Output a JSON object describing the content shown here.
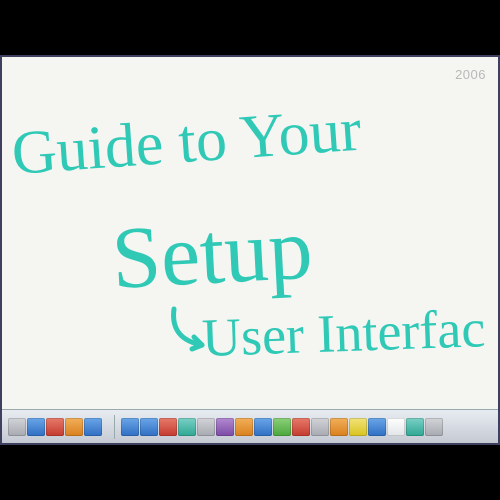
{
  "timestamp": "2006",
  "handwriting": {
    "line1": "Guide to Your",
    "line2": "Setup",
    "line3": "User Interfac"
  },
  "colors": {
    "ink": "#2fc9b6",
    "canvas": "#f5f5f2"
  },
  "taskbar": {
    "groups": [
      {
        "items": [
          {
            "name": "app-icon-1",
            "color": "c-gray"
          },
          {
            "name": "app-icon-2",
            "color": "c-blue"
          },
          {
            "name": "app-icon-3",
            "color": "c-red"
          },
          {
            "name": "app-icon-4",
            "color": "c-orange"
          },
          {
            "name": "app-icon-5",
            "color": "c-blue"
          }
        ]
      },
      {
        "items": [
          {
            "name": "tool-icon-1",
            "color": "c-blue"
          },
          {
            "name": "tool-icon-2",
            "color": "c-blue"
          },
          {
            "name": "tool-icon-3",
            "color": "c-red"
          },
          {
            "name": "tool-icon-4",
            "color": "c-teal"
          },
          {
            "name": "tool-icon-5",
            "color": "c-gray"
          },
          {
            "name": "tool-icon-6",
            "color": "c-purple"
          },
          {
            "name": "tool-icon-7",
            "color": "c-orange"
          },
          {
            "name": "tool-icon-8",
            "color": "c-blue"
          },
          {
            "name": "tool-icon-9",
            "color": "c-green"
          },
          {
            "name": "tool-icon-10",
            "color": "c-red"
          },
          {
            "name": "tool-icon-11",
            "color": "c-gray"
          },
          {
            "name": "tool-icon-12",
            "color": "c-orange"
          },
          {
            "name": "tool-icon-13",
            "color": "c-yellow"
          },
          {
            "name": "tool-icon-14",
            "color": "c-blue"
          },
          {
            "name": "tool-icon-15",
            "color": "c-white"
          },
          {
            "name": "tool-icon-16",
            "color": "c-teal"
          },
          {
            "name": "tool-icon-17",
            "color": "c-gray"
          }
        ]
      }
    ]
  }
}
